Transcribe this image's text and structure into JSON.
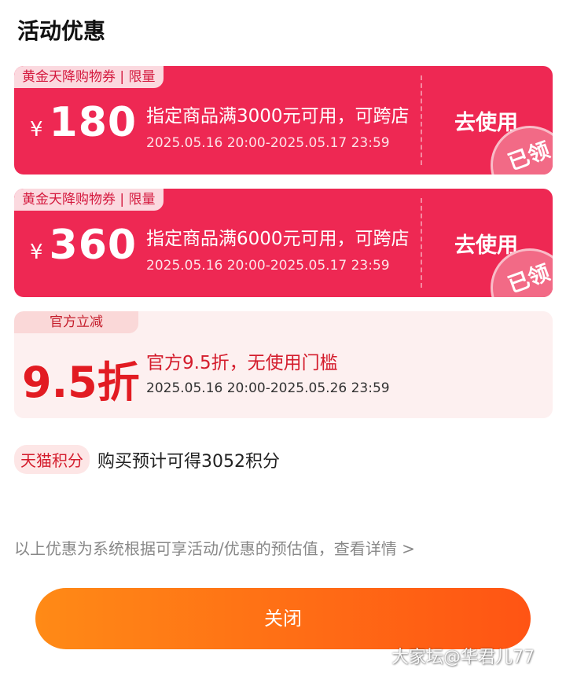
{
  "header": {
    "title": "活动优惠"
  },
  "coupons": [
    {
      "tag": "黄金天降购物券 | 限量",
      "currency": "¥",
      "amount": "180",
      "description": "指定商品满3000元可用，可跨店",
      "validity": "2025.05.16 20:00-2025.05.17 23:59",
      "action_label": "去使用",
      "stamp": "已领"
    },
    {
      "tag": "黄金天降购物券 | 限量",
      "currency": "¥",
      "amount": "360",
      "description": "指定商品满6000元可用，可跨店",
      "validity": "2025.05.16 20:00-2025.05.17 23:59",
      "action_label": "去使用",
      "stamp": "已领"
    }
  ],
  "official_discount": {
    "tag": "官方立减",
    "rate": "9.5折",
    "description": "官方9.5折，无使用门槛",
    "validity": "2025.05.16 20:00-2025.05.26 23:59"
  },
  "points": {
    "badge": "天猫积分",
    "text": "购买预计可得3052积分"
  },
  "footer": {
    "note": "以上优惠为系统根据可享活动/优惠的预估值，查看详情 >",
    "close_label": "关闭"
  },
  "watermark": "大家坛@华君儿77",
  "colors": {
    "coupon_red": "#ee2853",
    "discount_red": "#e21b22",
    "button_orange_start": "#ff8a16",
    "button_orange_end": "#ff5414"
  }
}
